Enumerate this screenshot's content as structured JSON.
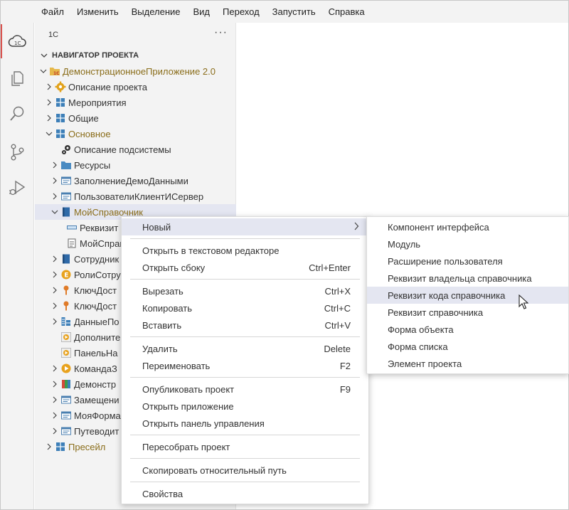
{
  "menubar": [
    "Файл",
    "Изменить",
    "Выделение",
    "Вид",
    "Переход",
    "Запустить",
    "Справка"
  ],
  "activity": [
    "cloud-1c-icon",
    "files-icon",
    "search-icon",
    "source-control-icon",
    "run-debug-icon"
  ],
  "sidebar": {
    "title": "1С",
    "more": "···",
    "section": "НАВИГАТОР ПРОЕКТА"
  },
  "tree": [
    {
      "label": "ДемонстрационноеПриложение 2.0",
      "indent": 0,
      "chevron": "down",
      "icon": "project-icon",
      "modified": true
    },
    {
      "label": "Описание проекта",
      "indent": 1,
      "chevron": "right",
      "icon": "gear-icon"
    },
    {
      "label": "Мероприятия",
      "indent": 1,
      "chevron": "right",
      "icon": "subsystem-icon"
    },
    {
      "label": "Общие",
      "indent": 1,
      "chevron": "right",
      "icon": "subsystem-icon"
    },
    {
      "label": "Основное",
      "indent": 1,
      "chevron": "down",
      "icon": "subsystem-icon",
      "modified": true
    },
    {
      "label": "Описание подсистемы",
      "indent": 2,
      "chevron": "none",
      "icon": "gears-icon"
    },
    {
      "label": "Ресурсы",
      "indent": 2,
      "chevron": "right",
      "icon": "folder-icon"
    },
    {
      "label": "ЗаполнениеДемоДанными",
      "indent": 2,
      "chevron": "right",
      "icon": "module-icon"
    },
    {
      "label": "ПользователиКлиентИСервер",
      "indent": 2,
      "chevron": "right",
      "icon": "module-icon"
    },
    {
      "label": "МойСправочник",
      "indent": 2,
      "chevron": "down",
      "icon": "catalog-icon",
      "modified": true,
      "selected": true
    },
    {
      "label": "Реквизит",
      "indent": 3,
      "chevron": "none",
      "icon": "attribute-icon"
    },
    {
      "label": "МойСправ",
      "indent": 3,
      "chevron": "none",
      "icon": "document-icon"
    },
    {
      "label": "Сотрудник",
      "indent": 2,
      "chevron": "right",
      "icon": "catalog-icon"
    },
    {
      "label": "РолиСотру",
      "indent": 2,
      "chevron": "right",
      "icon": "enum-icon"
    },
    {
      "label": "КлючДост",
      "indent": 2,
      "chevron": "right",
      "icon": "key-icon"
    },
    {
      "label": "КлючДост",
      "indent": 2,
      "chevron": "right",
      "icon": "key-icon"
    },
    {
      "label": "ДанныеПо",
      "indent": 2,
      "chevron": "right",
      "icon": "register-icon"
    },
    {
      "label": "Дополните",
      "indent": 2,
      "chevron": "none",
      "icon": "extension-icon"
    },
    {
      "label": "ПанельНа",
      "indent": 2,
      "chevron": "none",
      "icon": "extension-icon"
    },
    {
      "label": "КомандаЗ",
      "indent": 2,
      "chevron": "right",
      "icon": "command-icon"
    },
    {
      "label": "Демонстр",
      "indent": 2,
      "chevron": "right",
      "icon": "report-icon"
    },
    {
      "label": "Замещени",
      "indent": 2,
      "chevron": "right",
      "icon": "module-icon"
    },
    {
      "label": "МояФорма",
      "indent": 2,
      "chevron": "right",
      "icon": "module-icon"
    },
    {
      "label": "Путеводит",
      "indent": 2,
      "chevron": "right",
      "icon": "module-icon"
    },
    {
      "label": "Пресейл",
      "indent": 1,
      "chevron": "right",
      "icon": "subsystem-icon",
      "modified": true
    }
  ],
  "context_menu": [
    {
      "label": "Новый",
      "shortcut": "",
      "submenu": true,
      "highlighted": true
    },
    {
      "sep": true
    },
    {
      "label": "Открыть в текстовом редакторе",
      "shortcut": ""
    },
    {
      "label": "Открыть сбоку",
      "shortcut": "Ctrl+Enter"
    },
    {
      "sep": true
    },
    {
      "label": "Вырезать",
      "shortcut": "Ctrl+X"
    },
    {
      "label": "Копировать",
      "shortcut": "Ctrl+C"
    },
    {
      "label": "Вставить",
      "shortcut": "Ctrl+V"
    },
    {
      "sep": true
    },
    {
      "label": "Удалить",
      "shortcut": "Delete"
    },
    {
      "label": "Переименовать",
      "shortcut": "F2"
    },
    {
      "sep": true
    },
    {
      "label": "Опубликовать проект",
      "shortcut": "F9"
    },
    {
      "label": "Открыть приложение",
      "shortcut": ""
    },
    {
      "label": "Открыть панель управления",
      "shortcut": ""
    },
    {
      "sep": true
    },
    {
      "label": "Пересобрать проект",
      "shortcut": ""
    },
    {
      "sep": true
    },
    {
      "label": "Скопировать относительный путь",
      "shortcut": ""
    },
    {
      "sep": true
    },
    {
      "label": "Свойства",
      "shortcut": ""
    }
  ],
  "submenu": [
    {
      "label": "Компонент интерфейса"
    },
    {
      "label": "Модуль"
    },
    {
      "label": "Расширение пользователя"
    },
    {
      "label": "Реквизит владельца справочника"
    },
    {
      "label": "Реквизит кода справочника",
      "highlighted": true
    },
    {
      "label": "Реквизит справочника"
    },
    {
      "label": "Форма объекта"
    },
    {
      "label": "Форма списка"
    },
    {
      "label": "Элемент проекта"
    }
  ],
  "colors": {
    "accent": "#d9534f",
    "modified_text": "#8a6d1a",
    "selection": "#e4e6f1"
  }
}
